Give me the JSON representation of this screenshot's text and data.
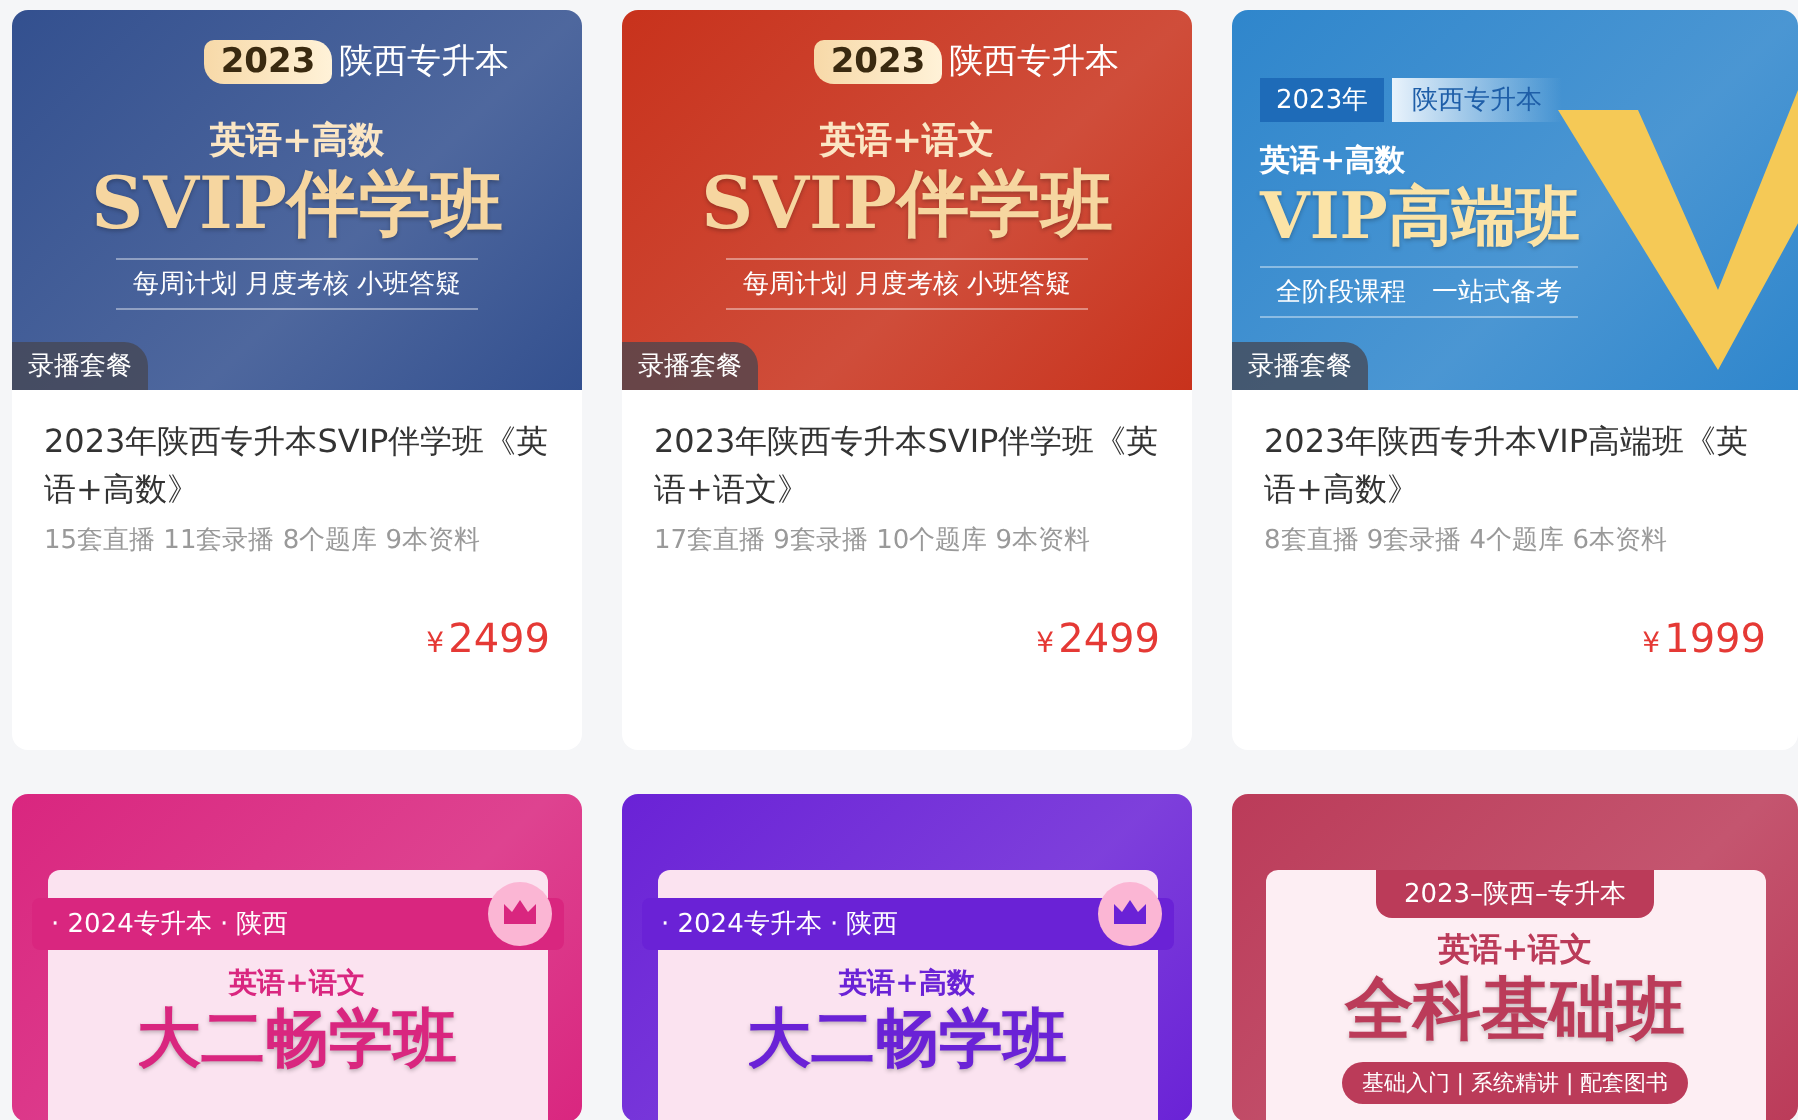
{
  "cards": [
    {
      "banner": {
        "kind": "classic",
        "color": "#33508f",
        "tag": [
          "2023",
          "陕西专升本"
        ],
        "subject": "英语+高数",
        "headline": "SVIP伴学班",
        "tagline": "每周计划 月度考核 小班答疑"
      },
      "badge": "录播套餐",
      "title": "2023年陕西专升本SVIP伴学班《英语+高数》",
      "stats": "15套直播 11套录播 8个题库 9本资料",
      "currency": "¥",
      "price": "2499"
    },
    {
      "banner": {
        "kind": "classic",
        "color": "#c8321c",
        "tag": [
          "2023",
          "陕西专升本"
        ],
        "subject": "英语+语文",
        "headline": "SVIP伴学班",
        "tagline": "每周计划 月度考核 小班答疑"
      },
      "badge": "录播套餐",
      "title": "2023年陕西专升本SVIP伴学班《英语+语文》",
      "stats": "17套直播 9套录播 10个题库 9本资料",
      "currency": "¥",
      "price": "2499"
    },
    {
      "banner": {
        "kind": "vip",
        "color": "#2f86cc",
        "tag": [
          "2023年",
          "陕西专升本"
        ],
        "subject": "英语+高数",
        "headline": "VIP高端班",
        "tagline": "全阶段课程　一站式备考"
      },
      "badge": "录播套餐",
      "title": "2023年陕西专升本VIP高端班《英语+高数》",
      "stats": "8套直播 9套录播 4个题库 6本资料",
      "currency": "¥",
      "price": "1999"
    },
    {
      "banner": {
        "kind": "ribbon",
        "color": "#d9267f",
        "tag": [
          "· 2024专升本 · 陕西"
        ],
        "subject": "英语+语文",
        "headline": "大二畅学班"
      }
    },
    {
      "banner": {
        "kind": "ribbon",
        "color": "#6a22d6",
        "tag": [
          "· 2024专升本 · 陕西"
        ],
        "subject": "英语+高数",
        "headline": "大二畅学班"
      }
    },
    {
      "banner": {
        "kind": "frame",
        "color": "#bb3b59",
        "tag": [
          "2023–陕西–专升本"
        ],
        "subject": "英语+语文",
        "headline": "全科基础班",
        "tagline": "基础入门 | 系统精讲 | 配套图书"
      }
    }
  ]
}
